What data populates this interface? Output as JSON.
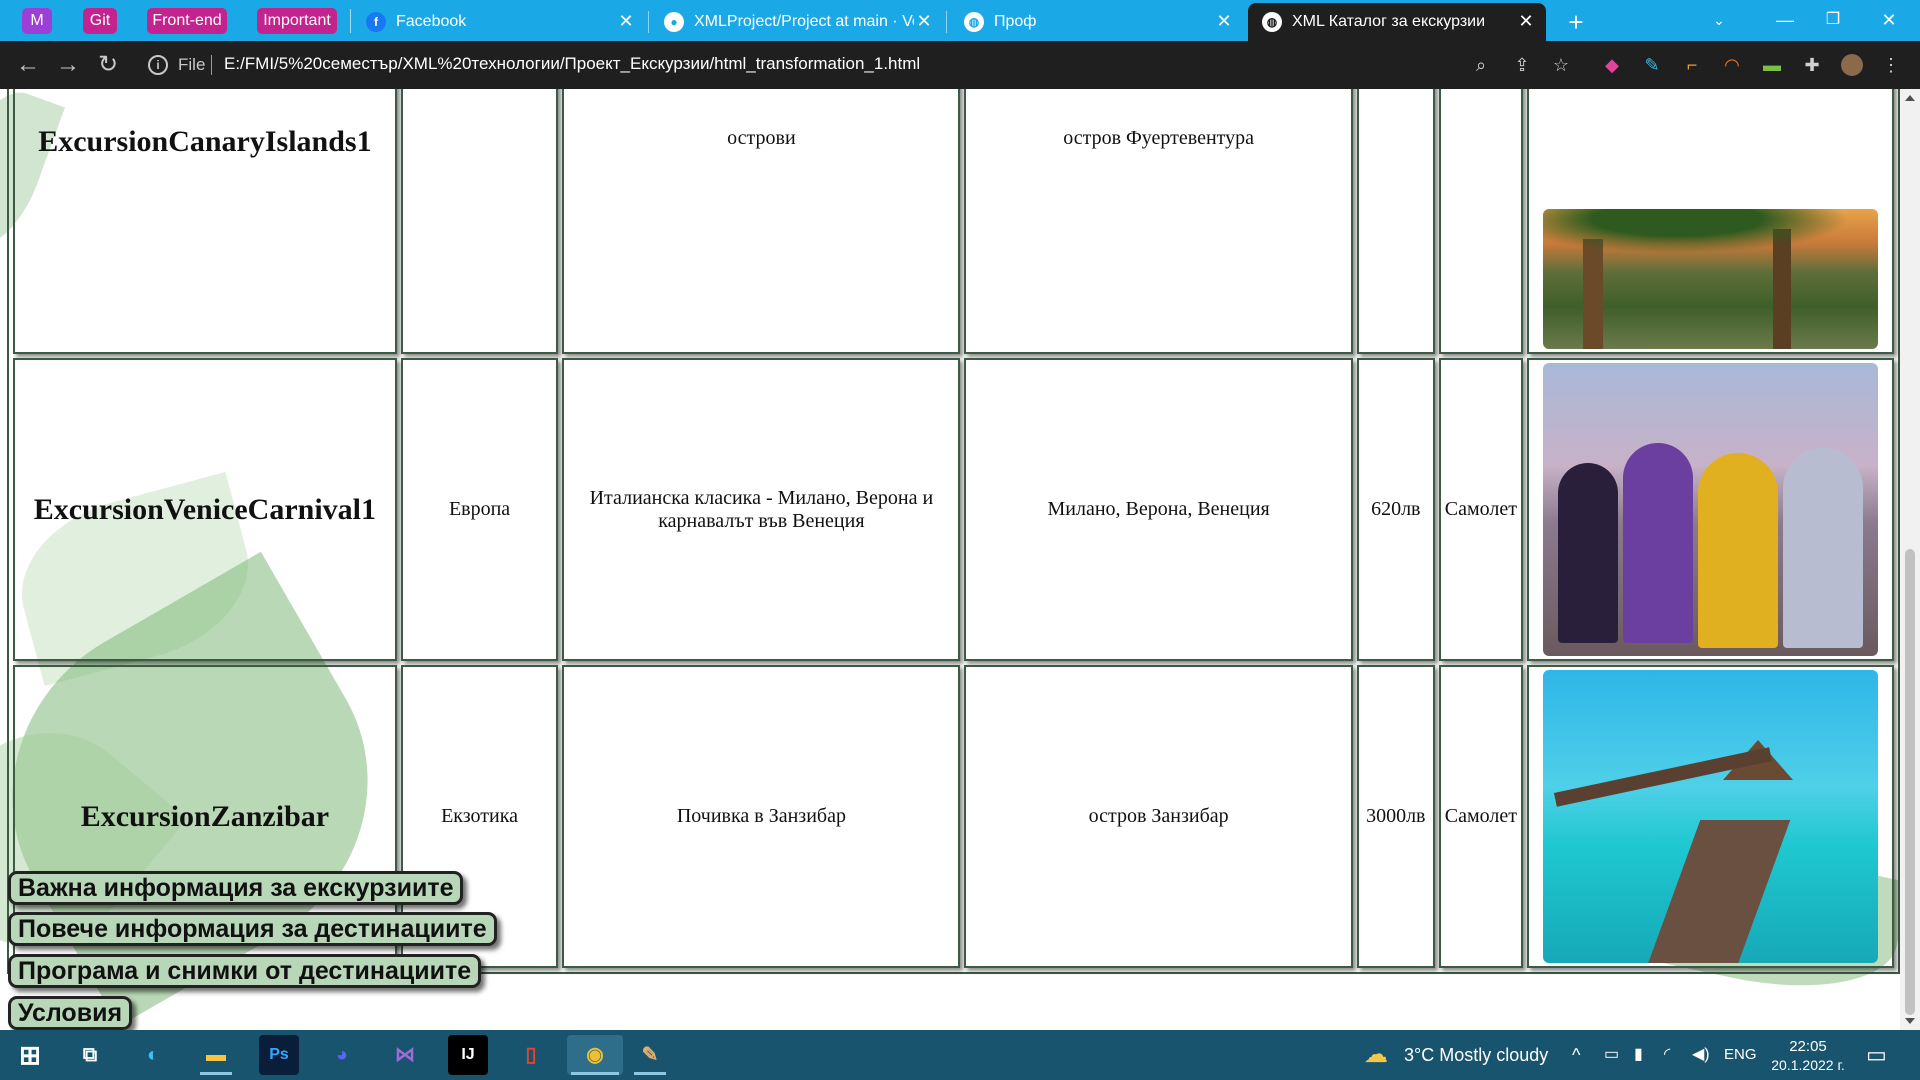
{
  "browser": {
    "bookmarks": [
      {
        "label": "M",
        "color": "#9b3fd6"
      },
      {
        "label": "Git",
        "color": "#c2238e"
      },
      {
        "label": "Front-end",
        "color": "#c2238e"
      },
      {
        "label": "Important",
        "color": "#c2238e"
      }
    ],
    "tabs": [
      {
        "title": "Facebook",
        "icon": "facebook-icon"
      },
      {
        "title": "XMLProject/Project at main · Vese",
        "icon": "github-icon"
      },
      {
        "title": "Проф",
        "icon": "globe-icon"
      },
      {
        "title": "XML Каталог за екскурзии",
        "icon": "globe-icon",
        "active": true
      }
    ],
    "file_label": "File",
    "url": "E:/FMI/5%20семестър/XML%20технологии/Проект_Екскурзии/html_transformation_1.html"
  },
  "catalog": {
    "rows": [
      {
        "name": "ExcursionCanaryIslands1",
        "region": "",
        "title": "острови",
        "destinations": "остров Фуертевентура",
        "price": "",
        "transport": "",
        "image": "palms-desert-photo"
      },
      {
        "name": "ExcursionVeniceCarnival1",
        "region": "Европа",
        "title": "Италианска класика - Милано, Верона и карнавалът във Венеция",
        "destinations": "Милано, Верона, Венеция",
        "price": "620лв",
        "transport": "Самолет",
        "image": "venice-carnival-photo"
      },
      {
        "name": "ExcursionZanzibar",
        "region": "Екзотика",
        "title": "Почивка в Занзибар",
        "destinations": "остров Занзибар",
        "price": "3000лв",
        "transport": "Самолет",
        "image": "zanzibar-pier-photo"
      }
    ]
  },
  "links": [
    "Важна информация за екскурзиите",
    "Повече информация за дестинациите",
    "Програма и снимки от дестинациите",
    "Условия"
  ],
  "taskbar": {
    "weather": "3°C  Mostly cloudy",
    "lang": "ENG",
    "time": "22:05",
    "date": "20.1.2022 г."
  }
}
